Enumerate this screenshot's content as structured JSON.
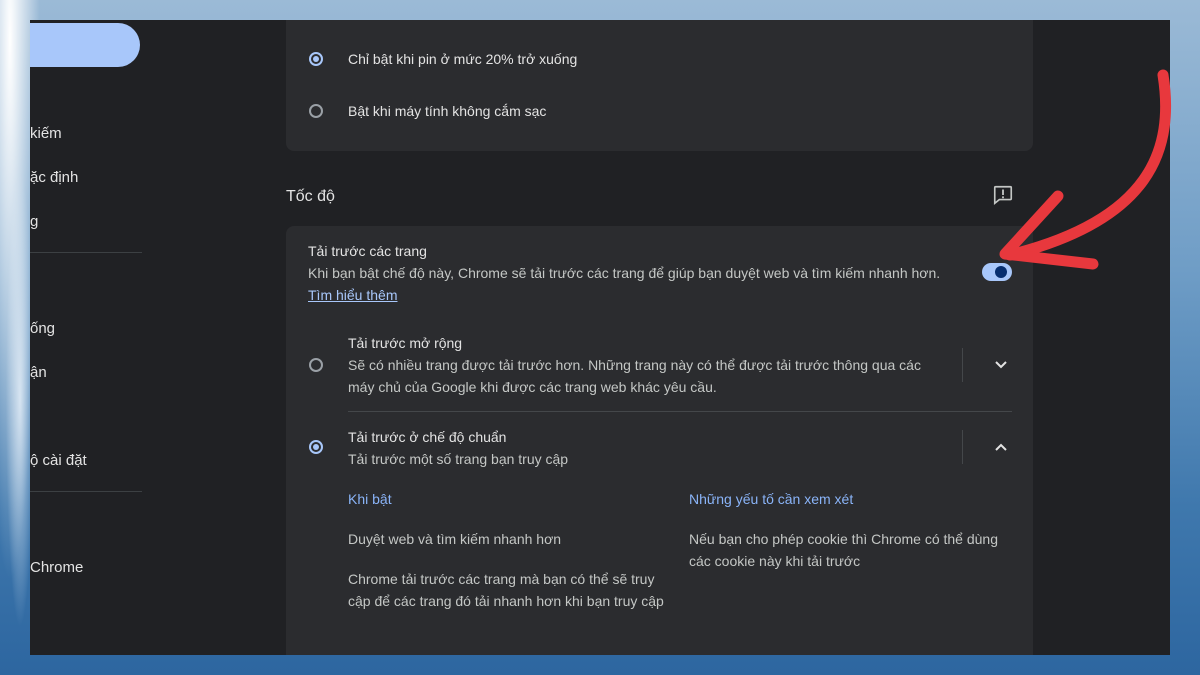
{
  "sidebar": {
    "items": [
      {
        "label": "kiếm"
      },
      {
        "label": "ặc định"
      },
      {
        "label": "g"
      },
      {
        "label": "ống"
      },
      {
        "label": "ận"
      },
      {
        "label": "ộ cài đặt"
      },
      {
        "label": "Chrome"
      }
    ]
  },
  "battery": {
    "option1": "Chỉ bật khi pin ở mức 20% trở xuống",
    "option2": "Bật khi máy tính không cắm sạc",
    "selected": 1
  },
  "speed": {
    "section_title": "Tốc độ",
    "feedback_icon": "feedback-icon",
    "preload": {
      "title": "Tải trước các trang",
      "description": "Khi bạn bật chế độ này, Chrome sẽ tải trước các trang để giúp bạn duyệt web và tìm kiếm nhanh hơn.",
      "learn_more": "Tìm hiểu thêm",
      "enabled": true
    },
    "extended": {
      "title": "Tải trước mở rộng",
      "desc_line1": "Sẽ có nhiều trang được tải trước hơn. Những trang này có thể được tải trước thông qua các",
      "desc_line2": "máy chủ của Google khi được các trang web khác yêu cầu.",
      "expand_icon": "chevron-down-icon"
    },
    "standard": {
      "title": "Tải trước ở chế độ chuẩn",
      "desc": "Tải trước một số trang bạn truy cập",
      "collapse_icon": "chevron-up-icon",
      "when_on_heading": "Khi bật",
      "when_on_1": "Duyệt web và tìm kiếm nhanh hơn",
      "when_on_2_line1": "Chrome tải trước các trang mà bạn có thể sẽ truy",
      "when_on_2_line2": "cập để các trang đó tải nhanh hơn khi bạn truy cập",
      "considerations_heading": "Những yếu tố cần xem xét",
      "consider_line1": "Nếu bạn cho phép cookie thì Chrome có thể dùng",
      "consider_line2": "các cookie này khi tải trước"
    }
  },
  "colors": {
    "accent": "#a8c7fa",
    "background": "#202124",
    "card": "#2b2c2f",
    "annotation_arrow": "#e8383d"
  }
}
